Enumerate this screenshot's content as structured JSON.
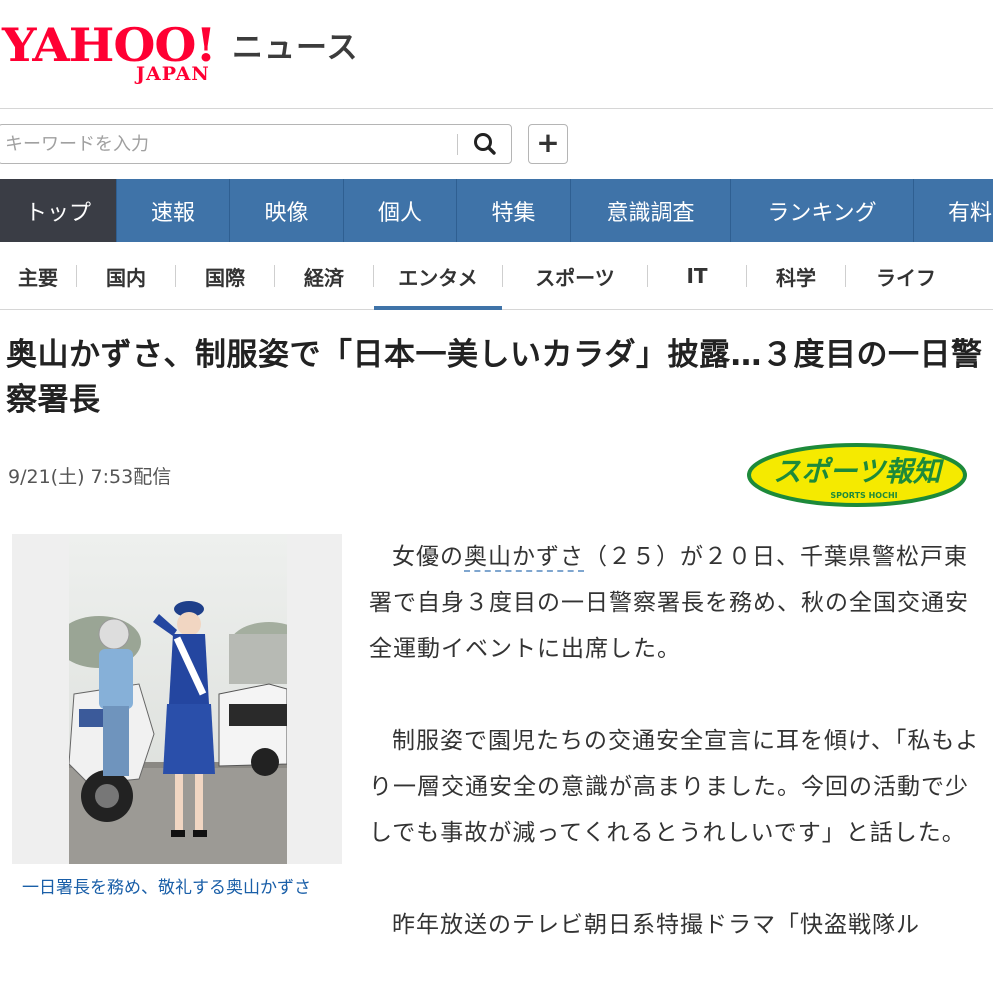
{
  "header": {
    "logo_yahoo": "YAHOO!",
    "logo_japan": "JAPAN",
    "logo_news": "ニュース"
  },
  "search": {
    "placeholder": "キーワードを入力",
    "value": ""
  },
  "main_nav": [
    {
      "label": "トップ",
      "active": true
    },
    {
      "label": "速報",
      "active": false
    },
    {
      "label": "映像",
      "active": false
    },
    {
      "label": "個人",
      "active": false
    },
    {
      "label": "特集",
      "active": false
    },
    {
      "label": "意識調査",
      "active": false
    },
    {
      "label": "ランキング",
      "active": false
    },
    {
      "label": "有料",
      "active": false
    }
  ],
  "sub_nav": [
    {
      "label": "主要",
      "active": false
    },
    {
      "label": "国内",
      "active": false
    },
    {
      "label": "国際",
      "active": false
    },
    {
      "label": "経済",
      "active": false
    },
    {
      "label": "エンタメ",
      "active": true
    },
    {
      "label": "スポーツ",
      "active": false
    },
    {
      "label": "IT",
      "active": false
    },
    {
      "label": "科学",
      "active": false
    },
    {
      "label": "ライフ",
      "active": false
    }
  ],
  "article": {
    "headline": "奥山かずさ、制服姿で「日本一美しいカラダ」披露…３度目の一日警察署長",
    "date": "9/21(土) 7:53配信",
    "source": {
      "name": "スポーツ報知",
      "sub": "SPORTS HOCHI",
      "colors": {
        "bg": "#f5ea00",
        "border": "#1d8a3a",
        "text": "#1d8a3a"
      }
    },
    "image_caption": "一日署長を務め、敬礼する奥山かずさ",
    "paragraphs": [
      {
        "before": "女優の",
        "link": "奥山かずさ",
        "after": "（２５）が２０日、千葉県警松戸東署で自身３度目の一日警察署長を務め、秋の全国交通安全運動イベントに出席した。"
      },
      {
        "before": "制服姿で園児たちの交通安全宣言に耳を傾け、「私もより一層交通安全の意識が高まりました。今回の活動で少しでも事故が減ってくれるとうれしいです」と話した。",
        "link": "",
        "after": ""
      },
      {
        "before": "昨年放送のテレビ朝日系特撮ドラマ「快盗戦隊ル",
        "link": "",
        "after": ""
      }
    ]
  },
  "colors": {
    "nav_blue": "#3f73a8",
    "nav_active": "#3a3d45",
    "brand_red": "#ff0033",
    "link_blue": "#1a5fa8"
  }
}
